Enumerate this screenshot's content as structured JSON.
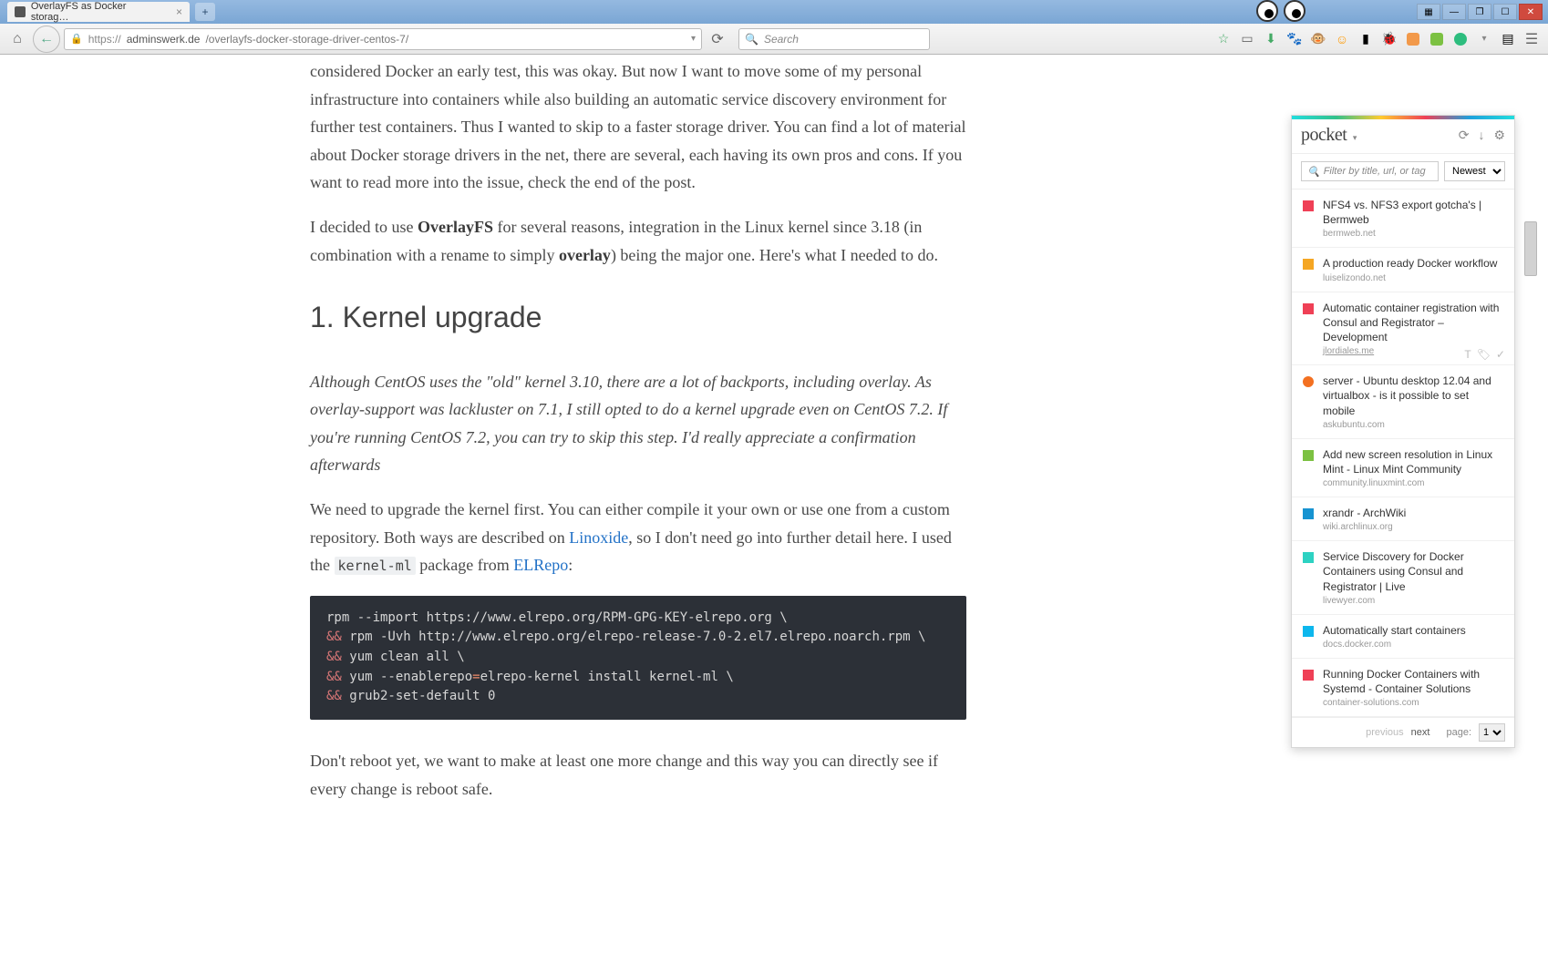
{
  "window": {
    "tab_title": "OverlayFS as Docker storag…",
    "new_tab": "+"
  },
  "nav": {
    "url_protocol": "https://",
    "url_domain": "adminswerk.de",
    "url_path": "/overlayfs-docker-storage-driver-centos-7/",
    "search_placeholder": "Search"
  },
  "article": {
    "p1_a": "considered Docker an early test, this was okay. But now I want to move some of my personal infrastructure into containers while also building an automatic service discovery environment for further test containers. Thus I wanted to skip to a faster storage driver. You can find a lot of material about Docker storage drivers in the net, there are several, each having its own pros and cons. If you want to read more into the issue, check the end of the post.",
    "p1_b1": "I decided to use ",
    "p1_b_strong": "OverlayFS",
    "p1_b2": " for several reasons, integration in the Linux kernel since 3.18 (in combination with a rename to simply ",
    "p1_b_strong2": "overlay",
    "p1_b3": ") being the major one. Here's what I needed to do.",
    "h2": "1. Kernel upgrade",
    "p2_italic": "Although CentOS uses the \"old\" kernel 3.10, there are a lot of backports, including overlay. As overlay-support was lackluster on 7.1, I still opted to do a kernel upgrade even on CentOS 7.2. If you're running CentOS 7.2, you can try to skip this step. I'd really appreciate a confirmation afterwards",
    "p3_a": "We need to upgrade the kernel first. You can either compile it your own or use one from a custom repository. Both ways are described on ",
    "p3_link1": "Linoxide",
    "p3_b": ", so I don't need go into further detail here. I used the ",
    "p3_code": "kernel-ml",
    "p3_c": " package from ",
    "p3_link2": "ELRepo",
    "p3_d": ":",
    "code_l1": "rpm --import https://www.elrepo.org/RPM-GPG-KEY-elrepo.org \\",
    "code_l2a": "&&",
    "code_l2b": " rpm -Uvh http://www.elrepo.org/elrepo-release-7.0-2.el7.elrepo.noarch.rpm \\",
    "code_l3a": "&&",
    "code_l3b": " yum clean all \\",
    "code_l4a": "&&",
    "code_l4b": " yum --enablerepo",
    "code_l4eq": "=",
    "code_l4c": "elrepo-kernel install kernel-ml \\",
    "code_l5a": "&&",
    "code_l5b": " grub2-set-default 0",
    "p4": "Don't reboot yet, we want to make at least one more change and this way you can directly see if every change is reboot safe."
  },
  "pocket": {
    "logo": "pocket",
    "filter_placeholder": "Filter by title, url, or tag",
    "sort_options": [
      "Newest"
    ],
    "sort_selected": "Newest",
    "items": [
      {
        "color": "#ef4056",
        "title": "NFS4 vs. NFS3 export gotcha's | Bermweb",
        "domain": "bermweb.net"
      },
      {
        "color": "#f5a623",
        "title": "A production ready Docker workflow",
        "domain": "luiselizondo.net"
      },
      {
        "color": "#ef4056",
        "title": "Automatic container registration with Consul and Registrator – Development",
        "domain": "jlordiales.me",
        "active": true
      },
      {
        "color": "#f37021",
        "title": "server - Ubuntu desktop 12.04 and virtualbox - is it possible to set mobile",
        "domain": "askubuntu.com",
        "round": true
      },
      {
        "color": "#7cc142",
        "title": "Add new screen resolution in Linux Mint - Linux Mint Community",
        "domain": "community.linuxmint.com"
      },
      {
        "color": "#1793d1",
        "title": "xrandr - ArchWiki",
        "domain": "wiki.archlinux.org"
      },
      {
        "color": "#2dd2c2",
        "title": "Service Discovery for Docker Containers using Consul and Registrator | Live",
        "domain": "livewyer.com"
      },
      {
        "color": "#0db7ed",
        "title": "Automatically start containers",
        "domain": "docs.docker.com"
      },
      {
        "color": "#ef4056",
        "title": "Running Docker Containers with Systemd - Container Solutions",
        "domain": "container-solutions.com"
      }
    ],
    "prev_label": "previous",
    "next_label": "next",
    "page_label": "page:",
    "page_value": "1"
  }
}
